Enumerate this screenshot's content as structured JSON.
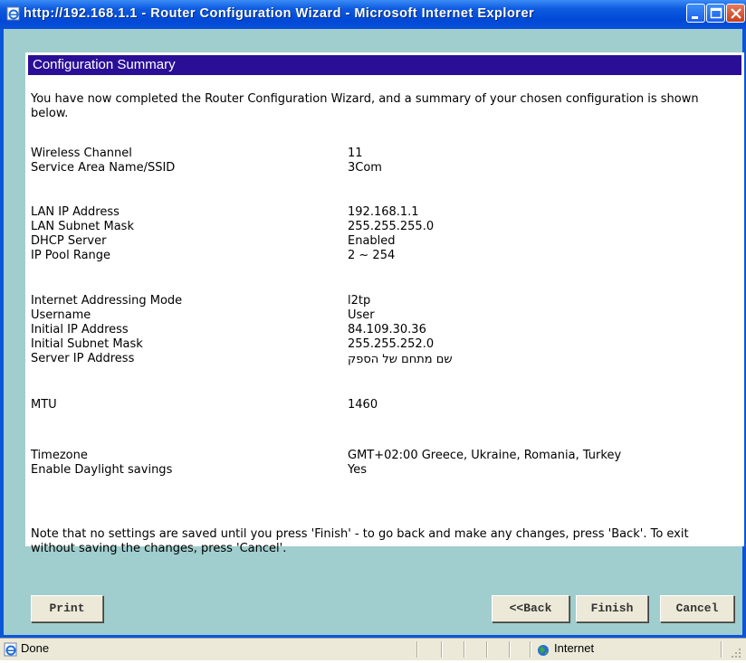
{
  "window": {
    "title": "http://192.168.1.1 - Router Configuration Wizard - Microsoft Internet Explorer"
  },
  "summary": {
    "title": "Configuration Summary",
    "intro": "You have now completed the Router Configuration Wizard, and a summary of your chosen configuration is shown below.",
    "rows": [
      {
        "label": "Wireless Channel",
        "value": "11"
      },
      {
        "label": "Service Area Name/SSID",
        "value": "3Com"
      },
      {
        "label": "LAN IP Address",
        "value": "192.168.1.1"
      },
      {
        "label": "LAN Subnet Mask",
        "value": "255.255.255.0"
      },
      {
        "label": "DHCP Server",
        "value": "Enabled"
      },
      {
        "label": "IP Pool Range",
        "value": "2 ~ 254"
      },
      {
        "label": "Internet Addressing Mode",
        "value": "l2tp"
      },
      {
        "label": "Username",
        "value": "User"
      },
      {
        "label": "Initial IP Address",
        "value": "84.109.30.36"
      },
      {
        "label": "Initial Subnet Mask",
        "value": "255.255.252.0"
      },
      {
        "label": "Server IP Address",
        "value": "שם מתחם של הספק"
      },
      {
        "label": "MTU",
        "value": "1460"
      },
      {
        "label": "Timezone",
        "value": "GMT+02:00 Greece, Ukraine, Romania, Turkey"
      },
      {
        "label": "Enable Daylight savings",
        "value": "Yes"
      }
    ],
    "note": "Note that no settings are saved until you press 'Finish' - to go back and make any changes, press 'Back'. To exit without saving the changes, press 'Cancel'."
  },
  "buttons": {
    "print": "Print",
    "back": "<<Back",
    "finish": "Finish",
    "cancel": "Cancel"
  },
  "statusbar": {
    "status": "Done",
    "zone": "Internet"
  },
  "colors": {
    "titlebar": "#0a50d8",
    "header": "#2a0f96",
    "client_bg": "#a0cdcd",
    "button_face": "#ece9d8"
  },
  "icons": {
    "title": "ie-page-icon",
    "status": "ie-page-icon",
    "zone": "globe-icon"
  }
}
